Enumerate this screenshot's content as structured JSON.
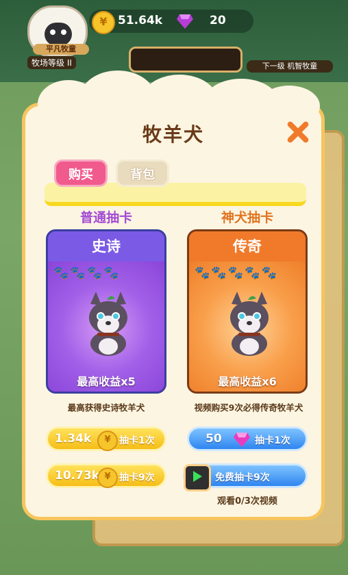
{
  "hud": {
    "coins": "51.64k",
    "gems": "20",
    "rank": "平凡牧童",
    "level": "牧场等级 II",
    "next_rank": "下一级 机智牧童"
  },
  "modal": {
    "title": "牧羊犬",
    "tabs": [
      {
        "label": "购买",
        "active": true
      },
      {
        "label": "背包",
        "active": false
      }
    ]
  },
  "columns": [
    {
      "title": "普通抽卡",
      "card_rarity": "史诗",
      "stars": 4,
      "card_sub": "最高收益x5",
      "desc": "最高获得史诗牧羊犬",
      "btn1": {
        "amount": "1.34k",
        "label": "抽卡1次"
      },
      "btn2": {
        "amount": "10.73k",
        "label": "抽卡9次"
      }
    },
    {
      "title": "神犬抽卡",
      "card_rarity": "传奇",
      "stars": 5,
      "card_sub": "最高收益x6",
      "desc": "视频购买9次必得传奇牧羊犬",
      "btn1": {
        "amount": "50",
        "label": "抽卡1次"
      },
      "btn2": {
        "label": "免费抽卡9次"
      },
      "watch": "观看0/3次视频"
    }
  ],
  "icons": [
    "coin-icon",
    "gem-icon",
    "paw-icon",
    "close-icon",
    "play-icon",
    "dog-icon"
  ],
  "colors": {
    "purple_card": "#8a4de0",
    "orange_card": "#f08a2c",
    "gold_button": "#f6be17",
    "blue_button": "#2f86f0",
    "close": "#f07b2a"
  }
}
